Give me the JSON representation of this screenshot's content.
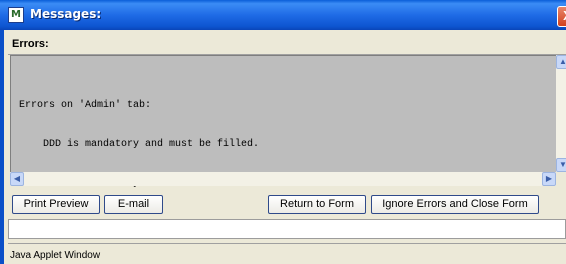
{
  "window": {
    "title": "Messages:",
    "close_label": "X"
  },
  "errors_label": "Errors:",
  "message_lines": [
    "Errors on 'Admin' tab:",
    "    DDD is mandatory and must be filled.",
    "    RTR is mandatory and must be filled."
  ],
  "buttons": {
    "print_preview": "Print Preview",
    "email": "E-mail",
    "return_to_form": "Return to Form",
    "ignore_close": "Ignore Errors and Close Form"
  },
  "status_bar": "Java Applet Window",
  "icons": {
    "app": "java-app-icon",
    "close": "close-icon",
    "scroll_up": "chevron-up-icon",
    "scroll_down": "chevron-down-icon",
    "scroll_left": "chevron-left-icon",
    "scroll_right": "chevron-right-icon"
  },
  "colors": {
    "titlebar": "#1f6be6",
    "textarea_bg": "#bdbdbd",
    "window_bg": "#ece9d8",
    "close_button": "#d2401e"
  }
}
